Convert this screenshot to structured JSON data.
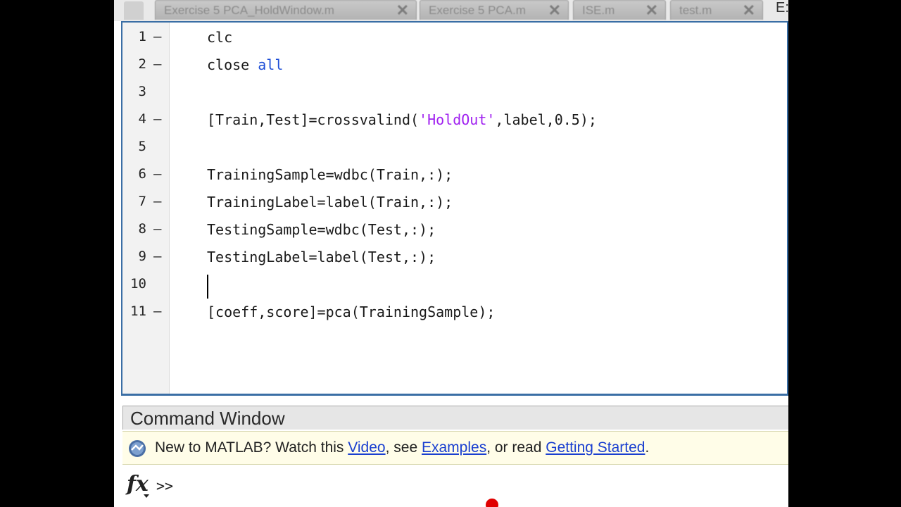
{
  "tabs": [
    {
      "label": "Exercise 5 PCA_HoldWindow.m",
      "close": "✕"
    },
    {
      "label": "Exercise 5 PCA.m",
      "close": "✕"
    },
    {
      "label": "ISE.m",
      "close": "✕"
    },
    {
      "label": "test.m",
      "close": "✕"
    }
  ],
  "tab_overflow": "E:",
  "editor": {
    "lines": [
      {
        "num": "1",
        "bp": "–"
      },
      {
        "num": "2",
        "bp": "–"
      },
      {
        "num": "3",
        "bp": ""
      },
      {
        "num": "4",
        "bp": "–"
      },
      {
        "num": "5",
        "bp": ""
      },
      {
        "num": "6",
        "bp": "–"
      },
      {
        "num": "7",
        "bp": "–"
      },
      {
        "num": "8",
        "bp": "–"
      },
      {
        "num": "9",
        "bp": "–"
      },
      {
        "num": "10",
        "bp": ""
      },
      {
        "num": "11",
        "bp": "–"
      }
    ],
    "code": {
      "l1": "clc",
      "l2_a": "close ",
      "l2_kw": "all",
      "l4_a": "[Train,Test]=crossvalind(",
      "l4_str": "'HoldOut'",
      "l4_b": ",label,0.5);",
      "l6": "TrainingSample=wdbc(Train,:);",
      "l7": "TrainingLabel=label(Train,:);",
      "l8": "TestingSample=wdbc(Test,:);",
      "l9": "TestingLabel=label(Test,:);",
      "l11": "[coeff,score]=pca(TrainingSample);"
    }
  },
  "command_window": {
    "title": "Command Window",
    "hint_prefix": "New to MATLAB? Watch this ",
    "hint_video": "Video",
    "hint_mid1": ", see ",
    "hint_examples": "Examples",
    "hint_mid2": ", or read ",
    "hint_getting_started": "Getting Started",
    "hint_suffix": ".",
    "fx": "fx",
    "prompt": ">>"
  },
  "colors": {
    "keyword": "#1f4fd6",
    "string": "#a020f0",
    "link": "#1a3fd0",
    "editor_border": "#3a6ea5"
  }
}
